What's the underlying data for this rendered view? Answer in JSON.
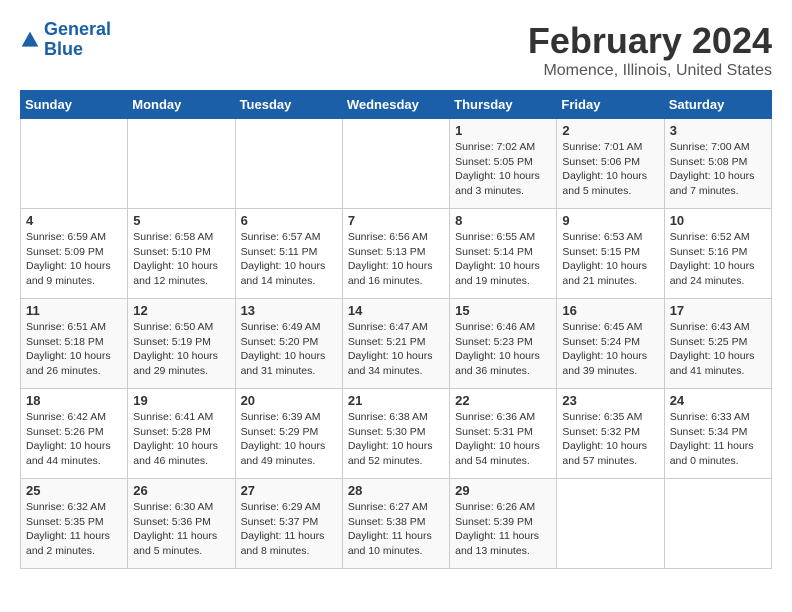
{
  "header": {
    "logo_line1": "General",
    "logo_line2": "Blue",
    "title": "February 2024",
    "subtitle": "Momence, Illinois, United States"
  },
  "columns": [
    "Sunday",
    "Monday",
    "Tuesday",
    "Wednesday",
    "Thursday",
    "Friday",
    "Saturday"
  ],
  "weeks": [
    [
      {
        "day": "",
        "info": ""
      },
      {
        "day": "",
        "info": ""
      },
      {
        "day": "",
        "info": ""
      },
      {
        "day": "",
        "info": ""
      },
      {
        "day": "1",
        "info": "Sunrise: 7:02 AM\nSunset: 5:05 PM\nDaylight: 10 hours\nand 3 minutes."
      },
      {
        "day": "2",
        "info": "Sunrise: 7:01 AM\nSunset: 5:06 PM\nDaylight: 10 hours\nand 5 minutes."
      },
      {
        "day": "3",
        "info": "Sunrise: 7:00 AM\nSunset: 5:08 PM\nDaylight: 10 hours\nand 7 minutes."
      }
    ],
    [
      {
        "day": "4",
        "info": "Sunrise: 6:59 AM\nSunset: 5:09 PM\nDaylight: 10 hours\nand 9 minutes."
      },
      {
        "day": "5",
        "info": "Sunrise: 6:58 AM\nSunset: 5:10 PM\nDaylight: 10 hours\nand 12 minutes."
      },
      {
        "day": "6",
        "info": "Sunrise: 6:57 AM\nSunset: 5:11 PM\nDaylight: 10 hours\nand 14 minutes."
      },
      {
        "day": "7",
        "info": "Sunrise: 6:56 AM\nSunset: 5:13 PM\nDaylight: 10 hours\nand 16 minutes."
      },
      {
        "day": "8",
        "info": "Sunrise: 6:55 AM\nSunset: 5:14 PM\nDaylight: 10 hours\nand 19 minutes."
      },
      {
        "day": "9",
        "info": "Sunrise: 6:53 AM\nSunset: 5:15 PM\nDaylight: 10 hours\nand 21 minutes."
      },
      {
        "day": "10",
        "info": "Sunrise: 6:52 AM\nSunset: 5:16 PM\nDaylight: 10 hours\nand 24 minutes."
      }
    ],
    [
      {
        "day": "11",
        "info": "Sunrise: 6:51 AM\nSunset: 5:18 PM\nDaylight: 10 hours\nand 26 minutes."
      },
      {
        "day": "12",
        "info": "Sunrise: 6:50 AM\nSunset: 5:19 PM\nDaylight: 10 hours\nand 29 minutes."
      },
      {
        "day": "13",
        "info": "Sunrise: 6:49 AM\nSunset: 5:20 PM\nDaylight: 10 hours\nand 31 minutes."
      },
      {
        "day": "14",
        "info": "Sunrise: 6:47 AM\nSunset: 5:21 PM\nDaylight: 10 hours\nand 34 minutes."
      },
      {
        "day": "15",
        "info": "Sunrise: 6:46 AM\nSunset: 5:23 PM\nDaylight: 10 hours\nand 36 minutes."
      },
      {
        "day": "16",
        "info": "Sunrise: 6:45 AM\nSunset: 5:24 PM\nDaylight: 10 hours\nand 39 minutes."
      },
      {
        "day": "17",
        "info": "Sunrise: 6:43 AM\nSunset: 5:25 PM\nDaylight: 10 hours\nand 41 minutes."
      }
    ],
    [
      {
        "day": "18",
        "info": "Sunrise: 6:42 AM\nSunset: 5:26 PM\nDaylight: 10 hours\nand 44 minutes."
      },
      {
        "day": "19",
        "info": "Sunrise: 6:41 AM\nSunset: 5:28 PM\nDaylight: 10 hours\nand 46 minutes."
      },
      {
        "day": "20",
        "info": "Sunrise: 6:39 AM\nSunset: 5:29 PM\nDaylight: 10 hours\nand 49 minutes."
      },
      {
        "day": "21",
        "info": "Sunrise: 6:38 AM\nSunset: 5:30 PM\nDaylight: 10 hours\nand 52 minutes."
      },
      {
        "day": "22",
        "info": "Sunrise: 6:36 AM\nSunset: 5:31 PM\nDaylight: 10 hours\nand 54 minutes."
      },
      {
        "day": "23",
        "info": "Sunrise: 6:35 AM\nSunset: 5:32 PM\nDaylight: 10 hours\nand 57 minutes."
      },
      {
        "day": "24",
        "info": "Sunrise: 6:33 AM\nSunset: 5:34 PM\nDaylight: 11 hours\nand 0 minutes."
      }
    ],
    [
      {
        "day": "25",
        "info": "Sunrise: 6:32 AM\nSunset: 5:35 PM\nDaylight: 11 hours\nand 2 minutes."
      },
      {
        "day": "26",
        "info": "Sunrise: 6:30 AM\nSunset: 5:36 PM\nDaylight: 11 hours\nand 5 minutes."
      },
      {
        "day": "27",
        "info": "Sunrise: 6:29 AM\nSunset: 5:37 PM\nDaylight: 11 hours\nand 8 minutes."
      },
      {
        "day": "28",
        "info": "Sunrise: 6:27 AM\nSunset: 5:38 PM\nDaylight: 11 hours\nand 10 minutes."
      },
      {
        "day": "29",
        "info": "Sunrise: 6:26 AM\nSunset: 5:39 PM\nDaylight: 11 hours\nand 13 minutes."
      },
      {
        "day": "",
        "info": ""
      },
      {
        "day": "",
        "info": ""
      }
    ]
  ]
}
